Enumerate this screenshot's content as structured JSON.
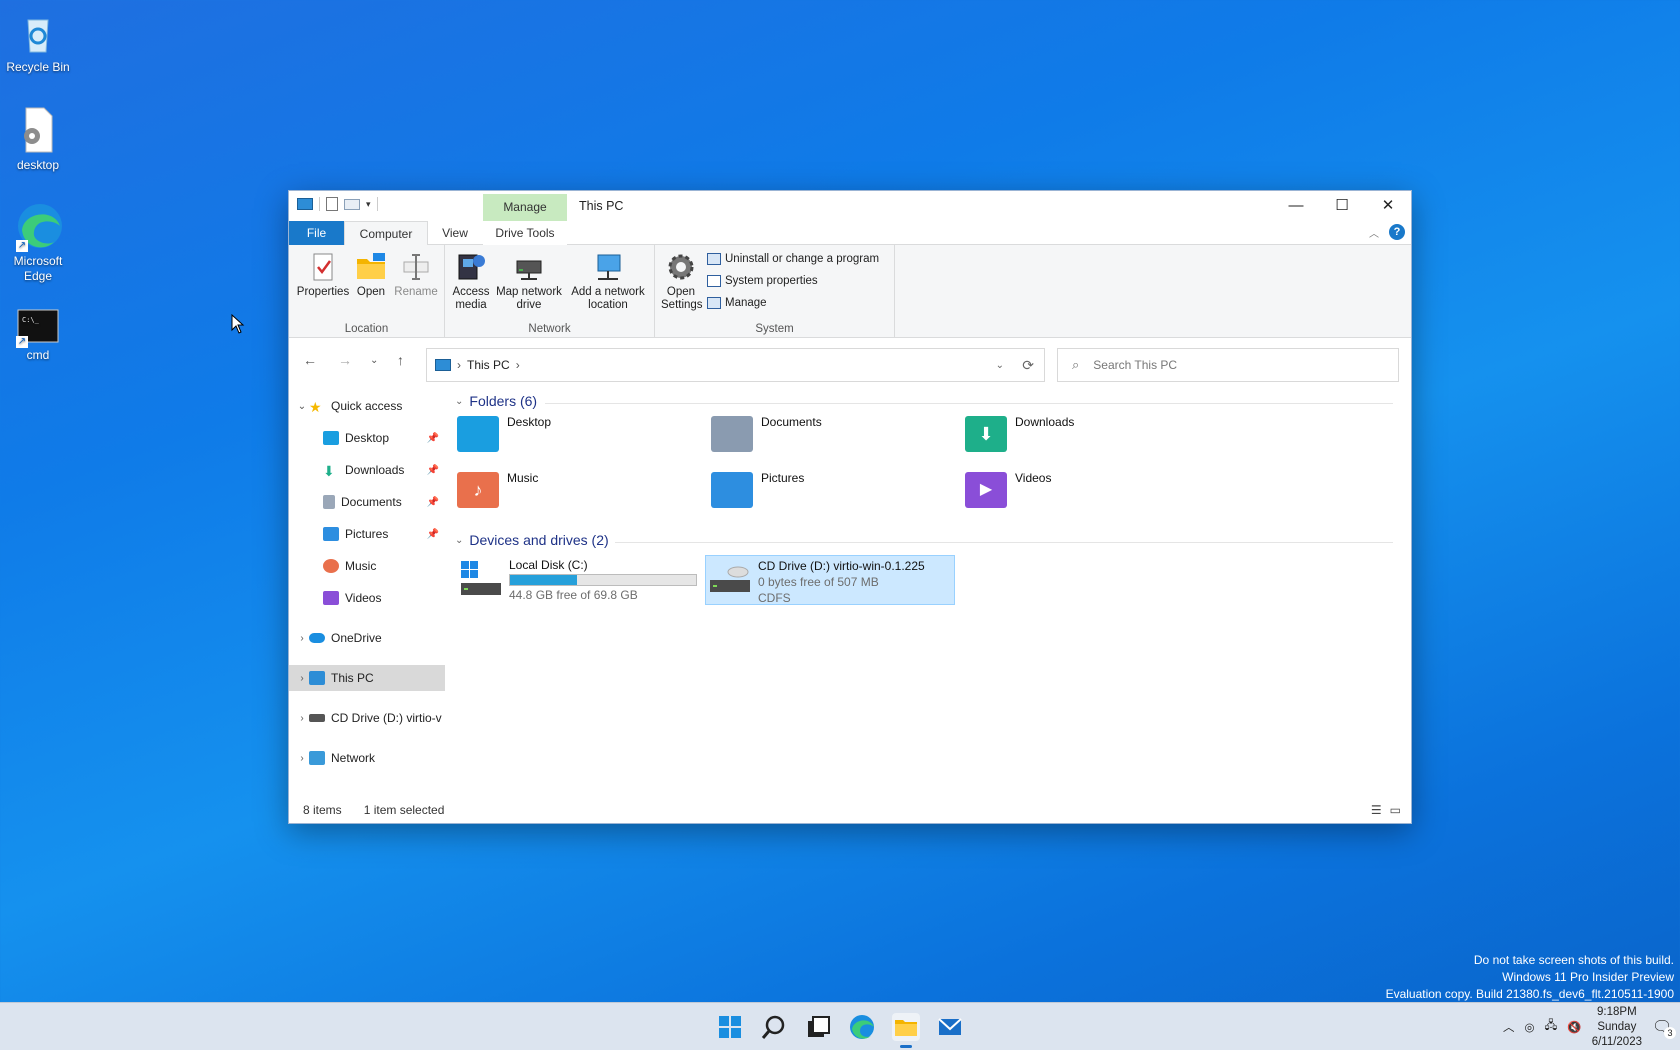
{
  "desktop": {
    "icons": [
      {
        "label": "Recycle Bin"
      },
      {
        "label": "desktop"
      },
      {
        "label": "Microsoft Edge"
      },
      {
        "label": "cmd"
      }
    ]
  },
  "window": {
    "title": "This PC",
    "context_tab_header": "Manage",
    "tabs": {
      "file": "File",
      "computer": "Computer",
      "view": "View",
      "drive_tools": "Drive Tools"
    },
    "controls": {
      "minimize": "—",
      "maximize": "☐",
      "close": "✕"
    },
    "ribbon": {
      "location": {
        "label": "Location",
        "properties": "Properties",
        "open": "Open",
        "rename": "Rename"
      },
      "network": {
        "label": "Network",
        "access_media": "Access media",
        "map_network_drive": "Map network drive",
        "add_network_location": "Add a network location"
      },
      "system": {
        "label": "System",
        "open_settings": "Open Settings",
        "uninstall": "Uninstall or change a program",
        "system_properties": "System properties",
        "manage": "Manage"
      }
    },
    "address": {
      "path": "This PC",
      "search_placeholder": "Search This PC"
    },
    "nav": {
      "quick_access": "Quick access",
      "items": [
        {
          "label": "Desktop"
        },
        {
          "label": "Downloads"
        },
        {
          "label": "Documents"
        },
        {
          "label": "Pictures"
        },
        {
          "label": "Music"
        },
        {
          "label": "Videos"
        }
      ],
      "onedrive": "OneDrive",
      "this_pc": "This PC",
      "cd_drive": "CD Drive (D:) virtio-v",
      "network": "Network"
    },
    "content": {
      "folders_header": "Folders (6)",
      "folders": [
        {
          "label": "Desktop",
          "color": "#1a9ee0"
        },
        {
          "label": "Documents",
          "color": "#8a9bb0"
        },
        {
          "label": "Downloads",
          "color": "#1eaf8a"
        },
        {
          "label": "Music",
          "color": "#e9704c"
        },
        {
          "label": "Pictures",
          "color": "#2d8ee0"
        },
        {
          "label": "Videos",
          "color": "#8a4ed8"
        }
      ],
      "drives_header": "Devices and drives (2)",
      "drives": [
        {
          "name": "Local Disk (C:)",
          "free": "44.8 GB free of 69.8 GB",
          "used_fraction": 0.358
        },
        {
          "name": "CD Drive (D:) virtio-win-0.1.225",
          "free": "0 bytes free of 507 MB",
          "fs": "CDFS"
        }
      ]
    },
    "status": {
      "items": "8 items",
      "selected": "1 item selected"
    }
  },
  "watermark": {
    "line1": "Do not take screen shots of this build.",
    "line2": "Windows 11 Pro Insider Preview",
    "line3": "Evaluation copy. Build 21380.fs_dev6_flt.210511-1900"
  },
  "taskbar": {
    "time": "9:18PM",
    "day": "Sunday",
    "date": "6/11/2023",
    "notifications": "3"
  }
}
